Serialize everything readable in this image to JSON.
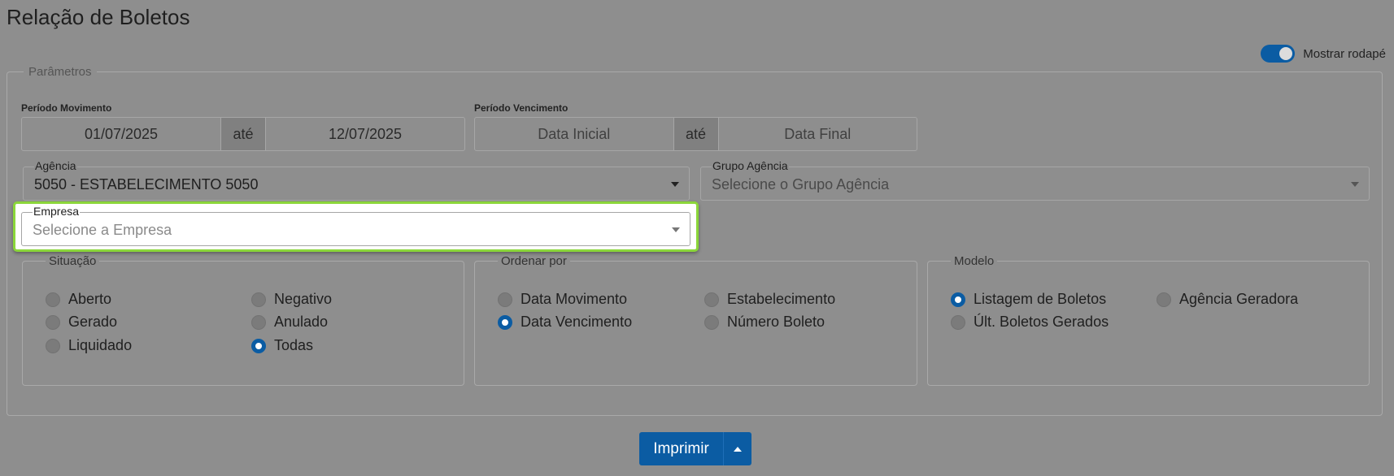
{
  "page": {
    "title": "Relação de Boletos"
  },
  "footer_toggle": {
    "label": "Mostrar rodapé",
    "on": true
  },
  "params": {
    "legend": "Parâmetros",
    "periodo_movimento": {
      "label": "Período Movimento",
      "start": "01/07/2025",
      "sep": "até",
      "end": "12/07/2025"
    },
    "periodo_vencimento": {
      "label": "Período Vencimento",
      "start_placeholder": "Data Inicial",
      "sep": "até",
      "end_placeholder": "Data Final"
    },
    "agencia": {
      "label": "Agência",
      "value": "5050 - ESTABELECIMENTO 5050"
    },
    "grupo_agencia": {
      "label": "Grupo Agência",
      "placeholder": "Selecione o Grupo Agência"
    },
    "empresa": {
      "label": "Empresa",
      "placeholder": "Selecione a Empresa"
    }
  },
  "situacao": {
    "legend": "Situação",
    "options": [
      "Aberto",
      "Negativo",
      "Gerado",
      "Anulado",
      "Liquidado",
      "Todas"
    ],
    "selected": "Todas"
  },
  "ordenar": {
    "legend": "Ordenar por",
    "options": [
      "Data Movimento",
      "Estabelecimento",
      "Data Vencimento",
      "Número Boleto"
    ],
    "selected": "Data Vencimento"
  },
  "modelo": {
    "legend": "Modelo",
    "options": [
      "Listagem de Boletos",
      "Agência Geradora",
      "Últ. Boletos Gerados"
    ],
    "selected": "Listagem de Boletos"
  },
  "actions": {
    "print_label": "Imprimir"
  },
  "colors": {
    "primary": "#0b5ca3",
    "highlight": "#8bd63a",
    "overlay": "#8e8e8e"
  }
}
